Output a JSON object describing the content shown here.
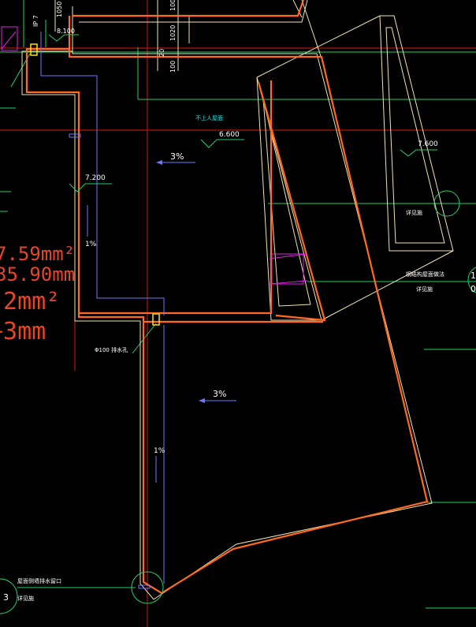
{
  "drawing": {
    "dimensions": {
      "d_1050": "1050",
      "d_100_top": "100",
      "d_1020": "1020",
      "d_20": "20",
      "d_100_bottom": "100",
      "d_8100": "8.100"
    },
    "roof_label": "不上人屋面",
    "levels": {
      "l_6600": "6.600",
      "l_7200": "7.200",
      "l_7600": "7.600"
    },
    "slopes": {
      "s_upper_3": "3%",
      "s_lower_3": "3%",
      "s_upper_1": "1%",
      "s_lower_1": "1%"
    },
    "notes": {
      "drain_pipe": "Φ100 排水孔",
      "right_note_1": "详见施",
      "right_note_2": "钢结构屋面做法",
      "right_note_3": "详见施",
      "bottom_note_1": "屋面侧墙排水留口",
      "bottom_note_2": "详见施"
    },
    "area_readouts": {
      "a1": "7.59mm²",
      "a2": "35.90mm",
      "a3": "-2mm²",
      "a4": "+3mm"
    },
    "edge_text": {
      "left_vertical": "IP 7",
      "right_1": "1",
      "right_0": "0",
      "bottom_left_3": "3"
    },
    "colors": {
      "background": "#000000",
      "orange_wall": "#ff6a1f",
      "pale_outline": "#f2e3b0",
      "green_grid": "#1fd16a",
      "red_axis": "#d8141c",
      "blue_pipe": "#6a78ff",
      "cyan_text": "#26e0e0",
      "white_text": "#ffffff",
      "magenta": "#e020e0",
      "yellow": "#ffe000"
    }
  }
}
